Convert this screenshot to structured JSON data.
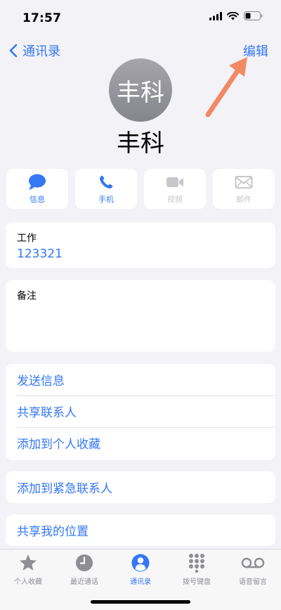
{
  "status_bar": {
    "time": "17:57"
  },
  "nav": {
    "back_label": "通讯录",
    "edit_label": "编辑"
  },
  "contact": {
    "avatar_text": "丰科",
    "name": "丰科"
  },
  "actions": [
    {
      "label": "信息",
      "enabled": true
    },
    {
      "label": "手机",
      "enabled": true
    },
    {
      "label": "视频",
      "enabled": false
    },
    {
      "label": "邮件",
      "enabled": false
    }
  ],
  "phone": {
    "label": "工作",
    "number": "123321"
  },
  "notes": {
    "label": "备注",
    "value": ""
  },
  "options_group_1": [
    "发送信息",
    "共享联系人",
    "添加到个人收藏"
  ],
  "options_group_2": [
    "添加到紧急联系人"
  ],
  "options_group_3": [
    "共享我的位置"
  ],
  "tabs": [
    {
      "label": "个人收藏",
      "icon": "star-icon",
      "active": false
    },
    {
      "label": "最近通话",
      "icon": "clock-icon",
      "active": false
    },
    {
      "label": "通讯录",
      "icon": "person-circle-icon",
      "active": true
    },
    {
      "label": "拨号键盘",
      "icon": "keypad-icon",
      "active": false
    },
    {
      "label": "语音留言",
      "icon": "voicemail-icon",
      "active": false
    }
  ],
  "colors": {
    "accent": "#3478f6",
    "background": "#f2f2f7",
    "annotation_arrow": "#f28a63"
  }
}
